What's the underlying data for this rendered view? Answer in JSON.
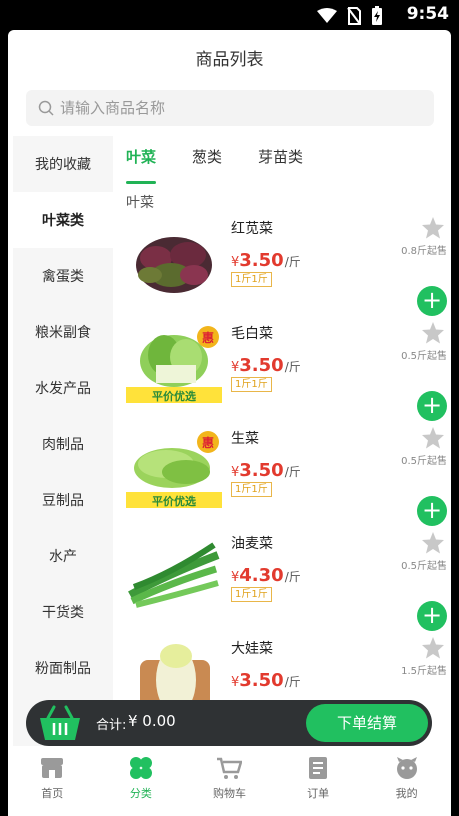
{
  "status": {
    "time": "9:54"
  },
  "header": {
    "title": "商品列表"
  },
  "search": {
    "placeholder": "请输入商品名称"
  },
  "sidebar": {
    "items": [
      {
        "label": "我的收藏",
        "active": false
      },
      {
        "label": "叶菜类",
        "active": true
      },
      {
        "label": "禽蛋类",
        "active": false
      },
      {
        "label": "粮米副食",
        "active": false
      },
      {
        "label": "水发产品",
        "active": false
      },
      {
        "label": "肉制品",
        "active": false
      },
      {
        "label": "豆制品",
        "active": false
      },
      {
        "label": "水产",
        "active": false
      },
      {
        "label": "干货类",
        "active": false
      },
      {
        "label": "粉面制品",
        "active": false
      }
    ]
  },
  "tabs": [
    {
      "label": "叶菜",
      "active": true
    },
    {
      "label": "葱类",
      "active": false
    },
    {
      "label": "芽苗类",
      "active": false
    }
  ],
  "section_title": "叶菜",
  "products": [
    {
      "name": "红苋菜",
      "currency": "¥",
      "price": "3.50",
      "unit": "/斤",
      "spec": "1斤1斤",
      "min_buy": "0.8斤起售",
      "image": "red-amaranth",
      "badge": false
    },
    {
      "name": "毛白菜",
      "currency": "¥",
      "price": "3.50",
      "unit": "/斤",
      "spec": "1斤1斤",
      "min_buy": "0.5斤起售",
      "image": "bok-choy",
      "badge": true
    },
    {
      "name": "生菜",
      "currency": "¥",
      "price": "3.50",
      "unit": "/斤",
      "spec": "1斤1斤",
      "min_buy": "0.5斤起售",
      "image": "lettuce",
      "badge": true
    },
    {
      "name": "油麦菜",
      "currency": "¥",
      "price": "4.30",
      "unit": "/斤",
      "spec": "1斤1斤",
      "min_buy": "0.5斤起售",
      "image": "indian-lettuce",
      "badge": false
    },
    {
      "name": "大娃菜",
      "currency": "¥",
      "price": "3.50",
      "unit": "/斤",
      "spec": "",
      "min_buy": "1.5斤起售",
      "image": "baby-cabbage",
      "badge": false
    }
  ],
  "badge": {
    "hui": "惠",
    "banner": "平价优选"
  },
  "cart": {
    "total_label": "合计:",
    "total_value": "¥ 0.00",
    "checkout_label": "下单结算"
  },
  "tabbar": [
    {
      "label": "首页",
      "icon": "home-shop-icon",
      "active": false
    },
    {
      "label": "分类",
      "icon": "category-icon",
      "active": true
    },
    {
      "label": "购物车",
      "icon": "cart-icon",
      "active": false
    },
    {
      "label": "订单",
      "icon": "order-icon",
      "active": false
    },
    {
      "label": "我的",
      "icon": "profile-icon",
      "active": false
    }
  ],
  "colors": {
    "accent": "#21c060",
    "price": "#e23a2e",
    "tag": "#e0a11a",
    "cartbar": "#2f3234"
  }
}
